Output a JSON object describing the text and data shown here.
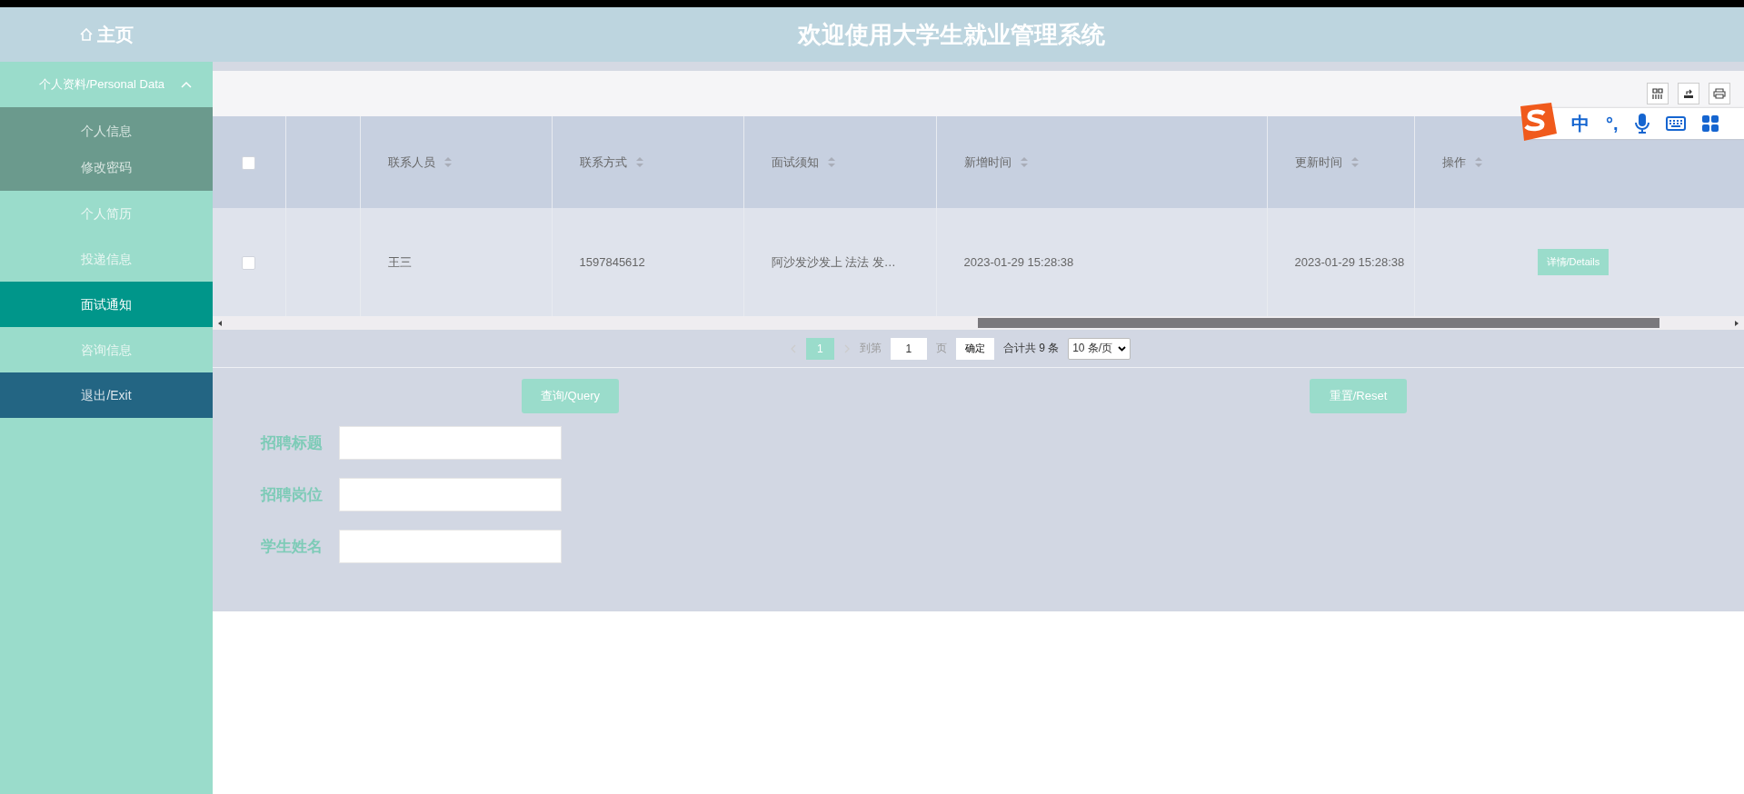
{
  "header": {
    "home": "主页",
    "title": "欢迎使用大学生就业管理系统"
  },
  "sidebar": {
    "group": {
      "label": "个人资料/Personal Data",
      "expanded": true,
      "children": [
        {
          "label": "个人信息"
        },
        {
          "label": "修改密码"
        }
      ]
    },
    "items": [
      {
        "label": "个人简历",
        "kind": "link",
        "selected": false
      },
      {
        "label": "投递信息",
        "kind": "link",
        "selected": false
      },
      {
        "label": "面试通知",
        "kind": "link",
        "selected": true
      },
      {
        "label": "咨询信息",
        "kind": "link",
        "selected": false
      },
      {
        "label": "退出/Exit",
        "kind": "exit",
        "selected": false
      }
    ]
  },
  "table": {
    "all_checked": false,
    "columns": [
      "联系人员",
      "联系方式",
      "面试须知",
      "新增时间",
      "更新时间",
      "操作"
    ],
    "rows": [
      {
        "checked": false,
        "cells": [
          "王三",
          "1597845612",
          "阿沙发沙发上 法法 发…",
          "2023-01-29 15:28:38",
          "2023-01-29 15:28:38"
        ],
        "action": "详情/Details"
      }
    ]
  },
  "pagination": {
    "pages": [
      {
        "label": "1",
        "selected": true
      }
    ],
    "goto_label": "到第",
    "goto_value": "1",
    "page_unit": "页",
    "confirm": "确定",
    "total": "合计共 9 条",
    "page_size": "10 条/页"
  },
  "search": {
    "query_button": "查询/Query",
    "reset_button": "重置/Reset",
    "fields": [
      {
        "label": "招聘标题"
      },
      {
        "label": "招聘岗位"
      },
      {
        "label": "学生姓名"
      }
    ]
  },
  "ime_toolbar": {
    "mode": "中",
    "punctuation": "°,"
  }
}
